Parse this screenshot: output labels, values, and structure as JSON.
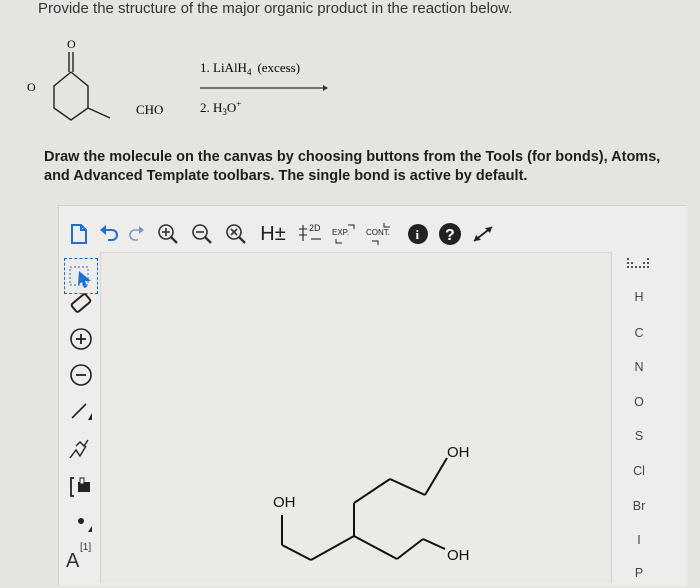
{
  "question": {
    "prompt": "Provide the structure of the major organic product in the reaction below."
  },
  "reaction": {
    "carbonyl_O": "O",
    "ring_O": "O",
    "substituent": "CHO",
    "step1": "1. LiAlH",
    "step1_sub": "4",
    "step1_tail": "(excess)",
    "step2": "2. H",
    "step2_sub": "3",
    "step2_tail": "O",
    "step2_sup": "+"
  },
  "instruction": "Draw the molecule on the canvas by choosing buttons from the Tools (for bonds), Atoms, and Advanced Template toolbars. The single bond is active by default.",
  "toolbar": {
    "hydrogen_label": "H±",
    "two_d_label": "2D",
    "exp_label": "EXP.",
    "cont_label": "CONT."
  },
  "left_tools": {
    "chain_label": "N⁄",
    "charge_label": "[1]",
    "atom_A": "A"
  },
  "atoms": [
    "H",
    "C",
    "N",
    "O",
    "S",
    "Cl",
    "Br",
    "I",
    "P"
  ],
  "drawing": {
    "oh_labels": [
      "OH",
      "OH",
      "OH"
    ]
  }
}
